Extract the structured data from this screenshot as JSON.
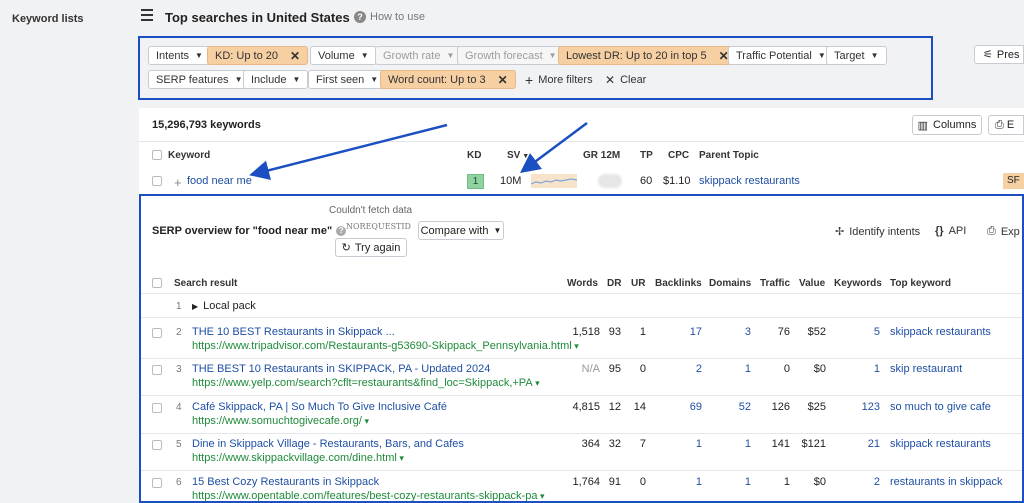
{
  "sidebar": {
    "title": "Keyword lists"
  },
  "header": {
    "title": "Top searches in United States",
    "howto": "How to use"
  },
  "filters": {
    "row1": [
      {
        "label": "Intents",
        "state": "normal",
        "caret": true
      },
      {
        "label": "KD: Up to 20",
        "state": "active",
        "close": true
      },
      {
        "label": "Volume",
        "state": "normal",
        "caret": true
      },
      {
        "label": "Growth rate",
        "state": "disabled",
        "caret": true
      },
      {
        "label": "Growth forecast",
        "state": "disabled",
        "caret": true
      },
      {
        "label": "Lowest DR: Up to 20 in top 5",
        "state": "active",
        "close": true
      },
      {
        "label": "Traffic Potential",
        "state": "normal",
        "caret": true
      },
      {
        "label": "Target",
        "state": "normal",
        "caret": true
      }
    ],
    "row2": [
      {
        "label": "SERP features",
        "state": "normal",
        "caret": true
      },
      {
        "label": "Include",
        "state": "normal",
        "caret": true
      },
      {
        "label": "First seen",
        "state": "normal",
        "caret": true
      },
      {
        "label": "Word count: Up to 3",
        "state": "active",
        "close": true
      }
    ],
    "more_filters": "More filters",
    "clear": "Clear",
    "presets": "Pres"
  },
  "results": {
    "count": "15,296,793 keywords",
    "columns_btn": "Columns",
    "export_btn": "E"
  },
  "keyword_table": {
    "headers": {
      "keyword": "Keyword",
      "kd": "KD",
      "sv": "SV",
      "gr": "GR 12M",
      "tp": "TP",
      "cpc": "CPC",
      "parent": "Parent Topic"
    },
    "row": {
      "keyword": "food near me",
      "kd": "1",
      "sv": "10M",
      "tp": "60",
      "cpc": "$1.10",
      "parent": "skippack restaurants",
      "serp_feature": "SF"
    }
  },
  "serp": {
    "title": "SERP overview for \"food near me\"",
    "fetch_error": "Couldn't fetch data",
    "error_code": "NOREQUESTID",
    "try_again": "Try again",
    "compare_with": "Compare with",
    "identify_intents": "Identify intents",
    "api": "API",
    "export": "Exp",
    "headers": {
      "result": "Search result",
      "words": "Words",
      "dr": "DR",
      "ur": "UR",
      "backlinks": "Backlinks",
      "domains": "Domains",
      "traffic": "Traffic",
      "value": "Value",
      "keywords": "Keywords",
      "top_keyword": "Top keyword"
    },
    "local_pack": {
      "num": "1",
      "label": "Local pack"
    },
    "rows": [
      {
        "num": "2",
        "title": "THE 10 BEST Restaurants in Skippack ...",
        "url": "https://www.tripadvisor.com/Restaurants-g53690-Skippack_Pennsylvania.html",
        "words": "1,518",
        "dr": "93",
        "ur": "1",
        "backlinks": "17",
        "domains": "3",
        "traffic": "76",
        "value": "$52",
        "keywords": "5",
        "top_keyword": "skippack restaurants"
      },
      {
        "num": "3",
        "title": "THE BEST 10 Restaurants in SKIPPACK, PA - Updated 2024",
        "url": "https://www.yelp.com/search?cflt=restaurants&find_loc=Skippack,+PA",
        "words": "N/A",
        "dr": "95",
        "ur": "0",
        "backlinks": "2",
        "domains": "1",
        "traffic": "0",
        "value": "$0",
        "keywords": "1",
        "top_keyword": "skip restaurant"
      },
      {
        "num": "4",
        "title": "Café Skippack, PA | So Much To Give Inclusive Café",
        "url": "https://www.somuchtogivecafe.org/",
        "words": "4,815",
        "dr": "12",
        "ur": "14",
        "backlinks": "69",
        "domains": "52",
        "traffic": "126",
        "value": "$25",
        "keywords": "123",
        "top_keyword": "so much to give cafe"
      },
      {
        "num": "5",
        "title": "Dine in Skippack Village - Restaurants, Bars, and Cafes",
        "url": "https://www.skippackvillage.com/dine.html",
        "words": "364",
        "dr": "32",
        "ur": "7",
        "backlinks": "1",
        "domains": "1",
        "traffic": "141",
        "value": "$121",
        "keywords": "21",
        "top_keyword": "skippack restaurants"
      },
      {
        "num": "6",
        "title": "15 Best Cozy Restaurants in Skippack",
        "url": "https://www.opentable.com/features/best-cozy-restaurants-skippack-pa",
        "words": "1,764",
        "dr": "91",
        "ur": "0",
        "backlinks": "1",
        "domains": "1",
        "traffic": "1",
        "value": "$0",
        "keywords": "2",
        "top_keyword": "restaurants in skippack"
      }
    ]
  },
  "colors": {
    "highlight_border": "#1b4fc2",
    "active_chip": "#f6cfa3",
    "link": "#1f4fa3",
    "url": "#1f8a3b"
  }
}
